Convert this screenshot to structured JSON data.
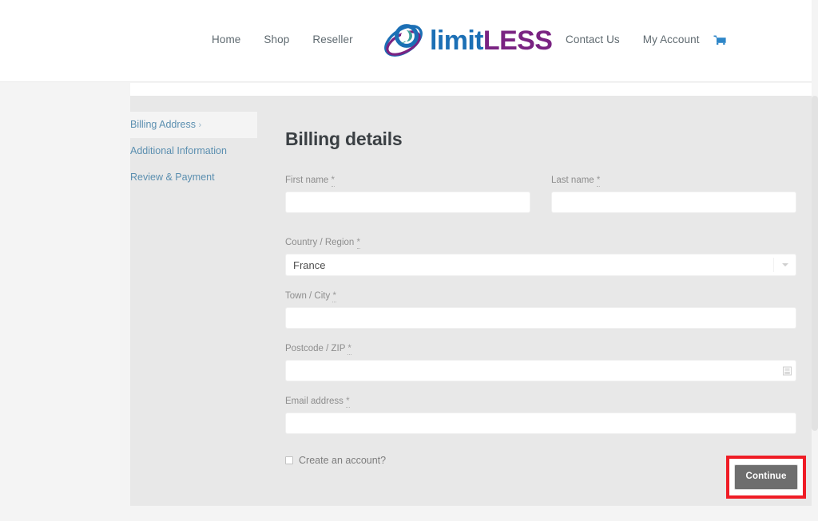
{
  "header": {
    "nav_left": [
      {
        "label": "Home",
        "name": "nav-home"
      },
      {
        "label": "Shop",
        "name": "nav-shop"
      },
      {
        "label": "Reseller",
        "name": "nav-reseller"
      }
    ],
    "nav_right": [
      {
        "label": "Contact Us",
        "name": "nav-contact-us"
      },
      {
        "label": "My Account",
        "name": "nav-my-account"
      }
    ],
    "cart_icon": "shopping-cart-icon",
    "logo": {
      "mark_icon": "limitless-swirl-logo-icon",
      "text_lower": "limit",
      "text_upper": "LESS",
      "color_blue": "#1b6fb5",
      "color_purple": "#7a2382"
    }
  },
  "checkout_steps": [
    {
      "label": "Billing Address",
      "chevron": "›",
      "active": true
    },
    {
      "label": "Additional Information",
      "chevron": "",
      "active": false
    },
    {
      "label": "Review & Payment",
      "chevron": "",
      "active": false
    }
  ],
  "billing": {
    "title": "Billing details",
    "required_mark": "*",
    "fields": {
      "first_name": {
        "label": "First name",
        "value": "",
        "placeholder": ""
      },
      "last_name": {
        "label": "Last name",
        "value": "",
        "placeholder": ""
      },
      "country": {
        "label": "Country / Region",
        "value": "France",
        "options": [
          "France"
        ]
      },
      "city": {
        "label": "Town / City",
        "value": "",
        "placeholder": ""
      },
      "postcode": {
        "label": "Postcode / ZIP",
        "value": "",
        "placeholder": "",
        "icon": "autofill-icon"
      },
      "email": {
        "label": "Email address",
        "value": "",
        "placeholder": ""
      }
    },
    "create_account_label": "Create an account?",
    "create_account_checked": false
  },
  "actions": {
    "continue_label": "Continue",
    "annotation_color": "#ef1c25"
  }
}
